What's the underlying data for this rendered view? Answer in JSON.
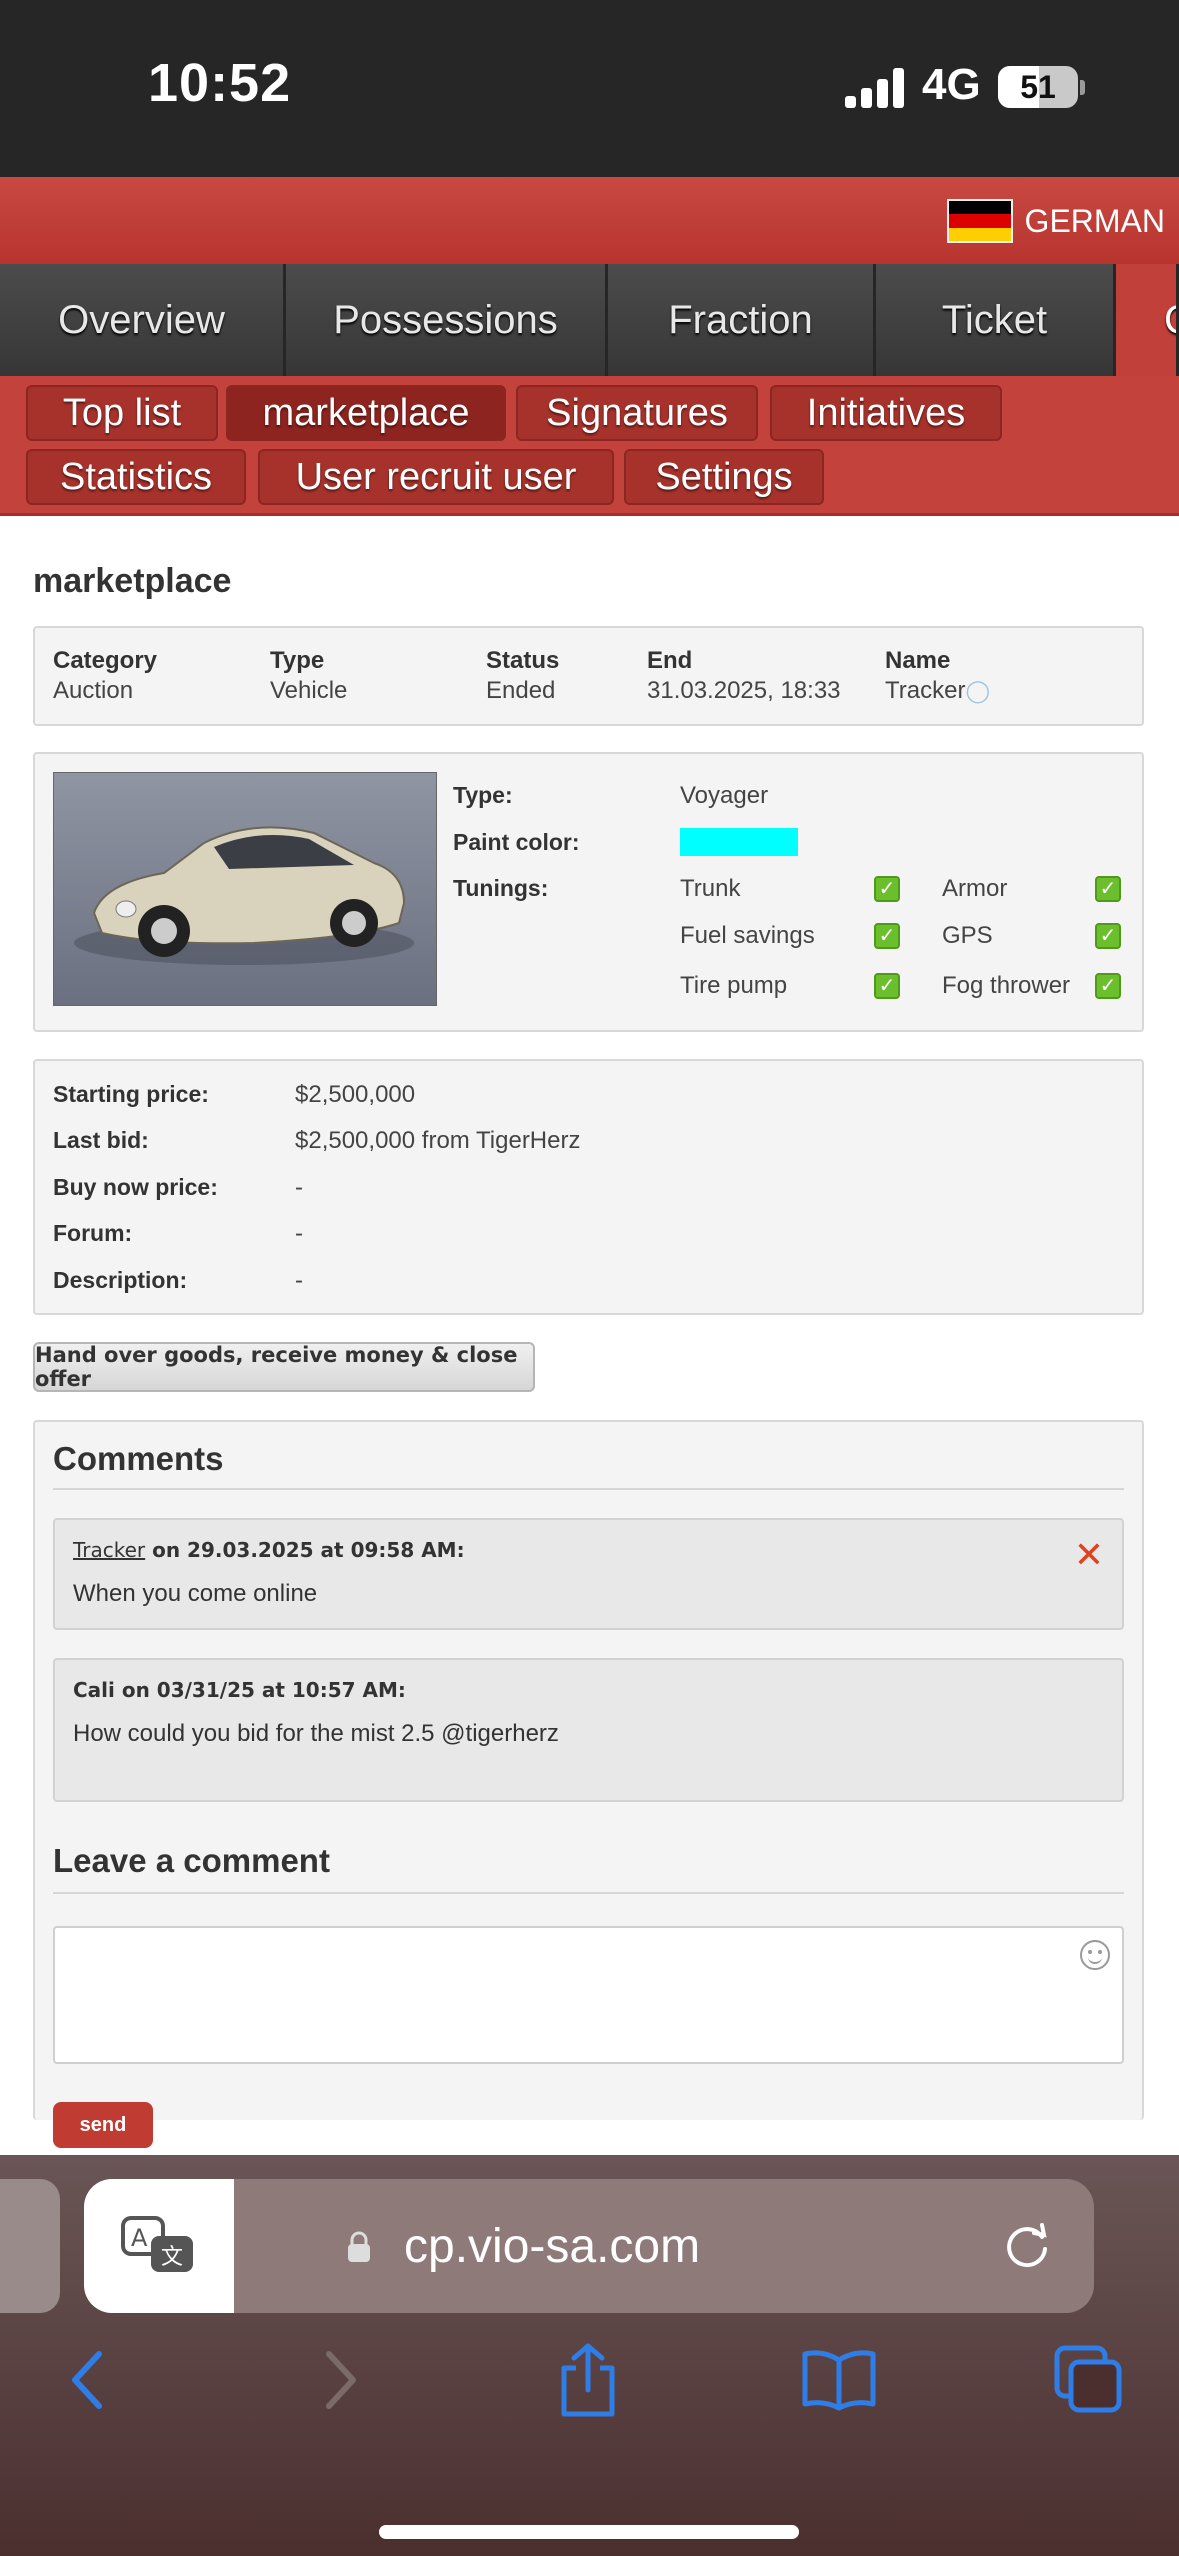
{
  "status_bar": {
    "time": "10:52",
    "network": "4G",
    "battery": "51"
  },
  "top_bar": {
    "language": "GERMAN"
  },
  "main_nav": [
    "Overview",
    "Possessions",
    "Fraction",
    "Ticket",
    "C"
  ],
  "sub_nav": [
    "Top list",
    "marketplace",
    "Signatures",
    "Initiatives",
    "Statistics",
    "User recruit user",
    "Settings"
  ],
  "page_title": "marketplace",
  "offer_info": {
    "category": {
      "label": "Category",
      "value": "Auction"
    },
    "type": {
      "label": "Type",
      "value": "Vehicle"
    },
    "status": {
      "label": "Status",
      "value": "Ended"
    },
    "end": {
      "label": "End",
      "value": "31.03.2025, 18:33"
    },
    "name": {
      "label": "Name",
      "value": "Tracker"
    }
  },
  "vehicle": {
    "type_label": "Type:",
    "type_value": "Voyager",
    "paint_label": "Paint color:",
    "paint_color": "#00ffff",
    "tunings_label": "Tunings:",
    "tunings": [
      "Trunk",
      "Armor",
      "Fuel savings",
      "GPS",
      "Tire pump",
      "Fog thrower"
    ]
  },
  "pricing": [
    {
      "label": "Starting price:",
      "value": "$2,500,000"
    },
    {
      "label": "Last bid:",
      "value": "$2,500,000 from TigerHerz"
    },
    {
      "label": "Buy now price:",
      "value": "-"
    },
    {
      "label": "Forum:",
      "value": "-"
    },
    {
      "label": "Description:",
      "value": "-"
    }
  ],
  "close_button": "Hand over goods, receive money & close offer",
  "comments": {
    "title": "Comments",
    "items": [
      {
        "author": "Tracker",
        "meta": " on 29.03.2025 at 09:58 AM:",
        "text": "When you come online"
      },
      {
        "author": "",
        "meta": "Cali on 03/31/25 at 10:57 AM:",
        "text": "How could you bid for the mist 2.5 @tigerherz"
      }
    ]
  },
  "leave_comment": {
    "title": "Leave a comment",
    "send": "send"
  },
  "browser": {
    "url": "cp.vio-sa.com"
  },
  "colors": {
    "accent": "#c3423b",
    "nav": "#3a3a3a",
    "check": "#6cbf2c"
  }
}
